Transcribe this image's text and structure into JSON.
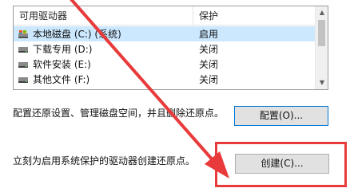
{
  "drive_list": {
    "columns": {
      "name": "可用驱动器",
      "protection": "保护"
    },
    "rows": [
      {
        "name": "本地磁盘 (C:) (系统)",
        "protection": "启用",
        "icon": "system-drive-icon",
        "selected": true
      },
      {
        "name": "下载专用 (D:)",
        "protection": "关闭",
        "icon": "drive-icon",
        "selected": false
      },
      {
        "name": "软件安装 (E:)",
        "protection": "关闭",
        "icon": "drive-icon",
        "selected": false
      },
      {
        "name": "其他文件 (F:)",
        "protection": "关闭",
        "icon": "drive-icon",
        "selected": false
      }
    ]
  },
  "configure": {
    "description": "配置还原设置、管理磁盘空间，并且删除还原点。",
    "button_label": "配置(O)..."
  },
  "create": {
    "description": "立刻为启用系统保护的驱动器创建还原点。",
    "button_label": "创建(C)..."
  },
  "scrollbar": {
    "up_arrow": "▲",
    "down_arrow": "▼"
  },
  "colors": {
    "selection": "#cce8ff",
    "annotation": "#e83a3a",
    "focus_border": "#0078d7"
  }
}
